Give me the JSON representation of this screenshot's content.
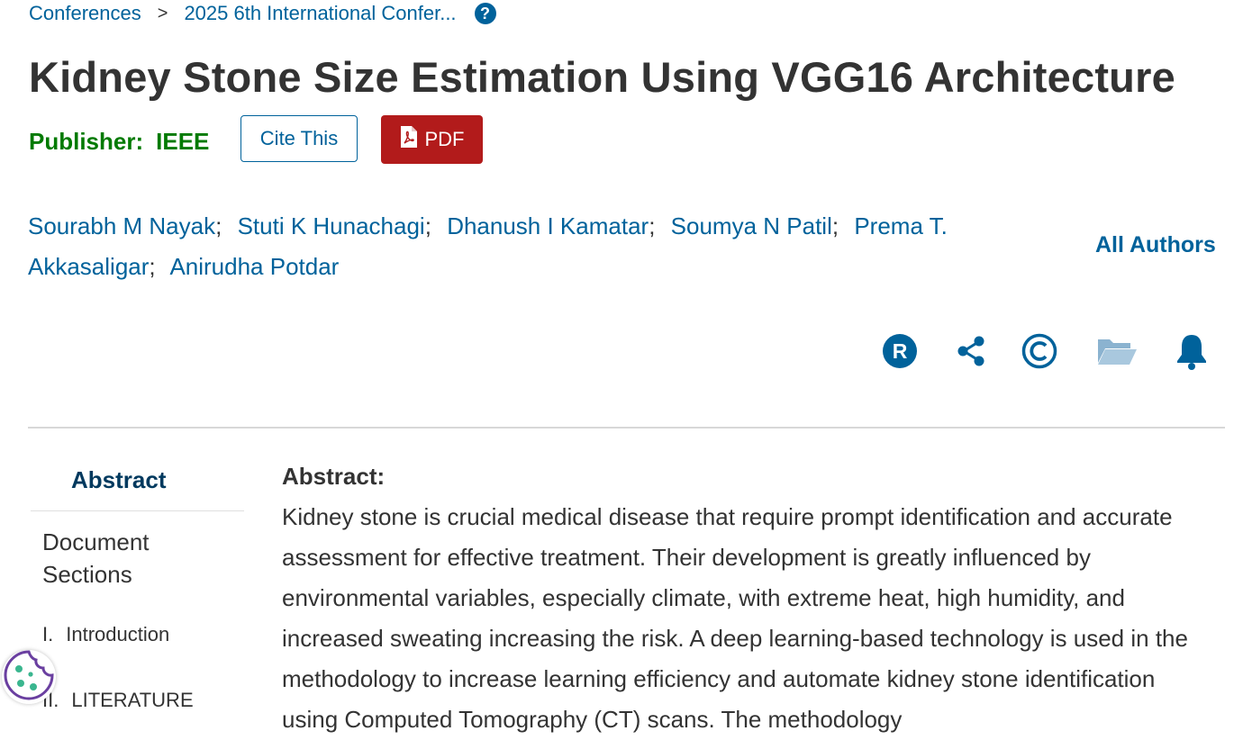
{
  "breadcrumb": {
    "items": [
      "Conferences",
      "2025 6th International Confer..."
    ],
    "separator": ">"
  },
  "title": "Kidney Stone Size Estimation Using VGG16 Architecture",
  "publisher": {
    "label": "Publisher:",
    "value": "IEEE"
  },
  "actions": {
    "cite_label": "Cite This",
    "pdf_label": "PDF"
  },
  "authors": {
    "names": [
      "Sourabh M Nayak",
      "Stuti K Hunachagi",
      "Dhanush I Kamatar",
      "Soumya N Patil",
      "Prema T. Akkasaligar",
      "Anirudha Potdar"
    ],
    "separator": ";",
    "all_authors_label": "All Authors"
  },
  "toolbar_icons": [
    "rights-icon",
    "share-icon",
    "copyright-icon",
    "folder-icon",
    "alert-bell-icon"
  ],
  "colors": {
    "link": "#00629b",
    "publisher": "#007a00",
    "pdf": "#b21b1b",
    "nav_active": "#00395e"
  },
  "sidebar": {
    "active": "Abstract",
    "heading": "Document Sections",
    "sections": [
      {
        "num": "I.",
        "label": "Introduction"
      },
      {
        "num": "II.",
        "label": "LITERATURE"
      }
    ]
  },
  "abstract": {
    "heading": "Abstract:",
    "text": "Kidney stone is crucial medical disease that require prompt identification and accurate assessment for effective treatment. Their development is greatly influenced by environmental variables, especially climate, with extreme heat, high humidity, and increased sweating increasing the risk. A deep learning-based technology is used in the methodology to increase learning efficiency and automate kidney stone identification using Computed Tomography (CT) scans. The methodology"
  }
}
